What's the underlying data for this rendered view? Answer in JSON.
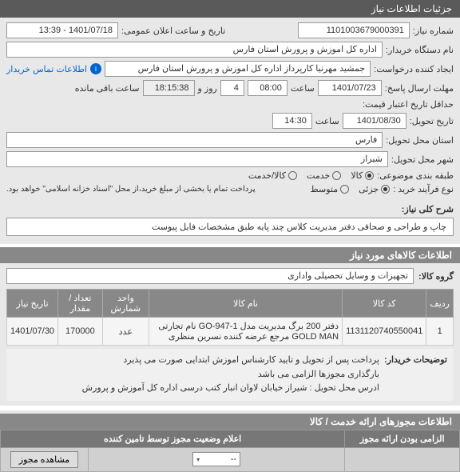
{
  "header": {
    "title": "جزئیات اطلاعات نیاز"
  },
  "form": {
    "need_no_label": "شماره نیاز:",
    "need_no": "1101003679000391",
    "announce_label": "تاریخ و ساعت اعلان عمومی:",
    "announce_val": "1401/07/18 - 13:39",
    "org_label": "نام دستگاه خریدار:",
    "org_val": "اداره کل اموزش و پرورش استان فارس",
    "requester_label": "ایجاد کننده درخواست:",
    "requester_val": "جمشید مهرنیا کارپرداز اداره کل اموزش و پرورش استان فارس",
    "contact_link": "اطلاعات تماس خریدار",
    "deadline_label": "مهلت ارسال پاسخ:",
    "deadline_date": "1401/07/23",
    "time_label": "ساعت",
    "deadline_time": "08:00",
    "days_val": "4",
    "days_and": "روز و",
    "countdown": "18:15:38",
    "remaining": "ساعت باقی مانده",
    "credit_min_label": "حداقل تاریخ اعتبار قیمت:",
    "delivery_date_label": "تاریخ تحویل:",
    "delivery_date": "1401/08/30",
    "delivery_time": "14:30",
    "province_label": "استان محل تحویل:",
    "province_val": "فارس",
    "city_label": "شهر محل تحویل:",
    "city_val": "شیراز",
    "budget_label": "طبقه بندی موضوعی:",
    "budget_options": {
      "goods": "کالا",
      "service": "خدمت",
      "both": "کالا/خدمت"
    },
    "process_label": "نوع فرآیند خرید :",
    "process_options": {
      "partial": "جزئی",
      "medium": "متوسط"
    },
    "payment_note": "پرداخت تمام یا بخشی از مبلغ خرید،از محل \"اسناد خزانه اسلامی\" خواهد بود."
  },
  "desc": {
    "label": "شرح کلی نیاز:",
    "text": "چاپ و طراحی و صحافی دفتر مدیریت کلاس چند پایه طبق مشخصات فایل پیوست"
  },
  "goods": {
    "section_title": "اطلاعات کالاهای مورد نیاز",
    "group_label": "گروه کالا:",
    "group_val": "تجهیزات و وسایل تحصیلی واداری",
    "columns": {
      "row": "ردیف",
      "code": "کد کالا",
      "name": "نام کالا",
      "unit": "واحد شمارش",
      "qty": "تعداد / مقدار",
      "need_date": "تاریخ نیاز"
    },
    "items": [
      {
        "row": "1",
        "code": "1131120740550041",
        "name": "دفتر 200 برگ مدیریت مدل GO-947-1 نام تجارتی GOLD MAN مرجع عرضه کننده نسرین منظری",
        "unit": "عدد",
        "qty": "170000",
        "need_date": "1401/07/30"
      }
    ]
  },
  "buyer_notes": {
    "label": "توضیحات خریدار:",
    "text": "پرداخت پس از تحویل و تایید کارشناس اموزش ابتدایی صورت می پذیرد\nبارگذاری مجوزها الزامی می باشد\nادرس محل تحویل : شیراز خیابان لاوان انبار کتب درسی اداره کل آموزش و پرورش"
  },
  "auth": {
    "section_title": "اطلاعات مجوزهای ارائه خدمت / کالا",
    "columns": {
      "mandatory": "الزامی بودن ارائه مجوز",
      "status": "اعلام وضعیت مجوز توسط تامین کننده"
    },
    "select_placeholder": "--",
    "view_btn": "مشاهده مجوز"
  }
}
